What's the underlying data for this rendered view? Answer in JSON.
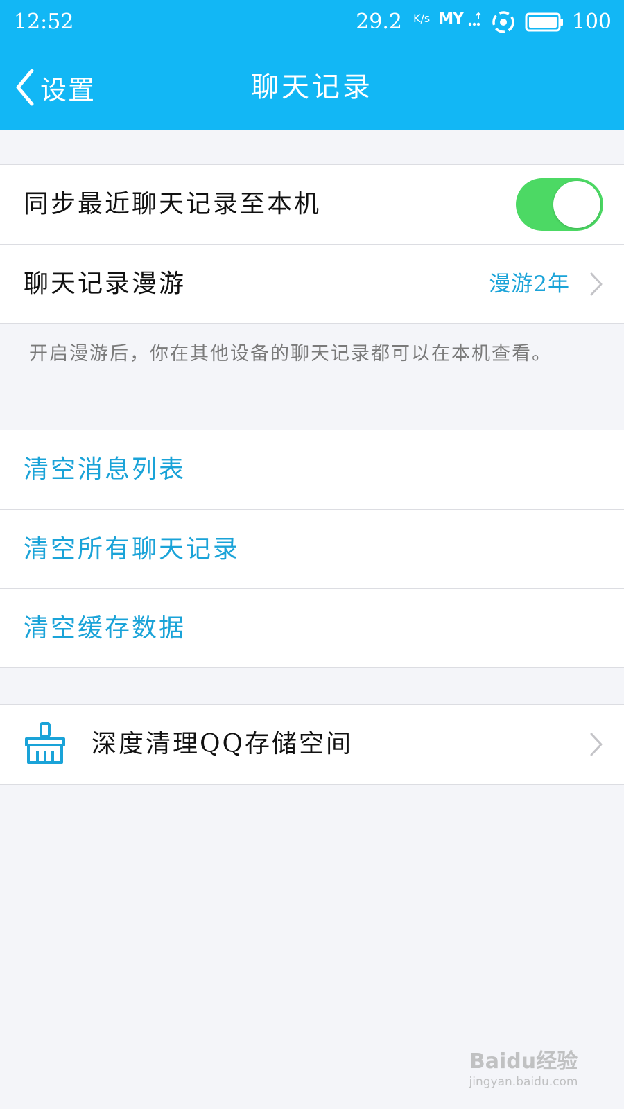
{
  "status_bar": {
    "time": "12:52",
    "net_speed": "29.2",
    "net_speed_unit": "K/s",
    "carrier": "MY",
    "battery": "100"
  },
  "nav": {
    "back_label": "设置",
    "title": "聊天记录"
  },
  "sync_row": {
    "label": "同步最近聊天记录至本机",
    "toggle_on": true
  },
  "roaming_row": {
    "label": "聊天记录漫游",
    "value": "漫游2年"
  },
  "roaming_hint": "开启漫游后，你在其他设备的聊天记录都可以在本机查看。",
  "clear_actions": [
    "清空消息列表",
    "清空所有聊天记录",
    "清空缓存数据"
  ],
  "deep_clean_row": {
    "label": "深度清理QQ存储空间",
    "icon": "broom-icon"
  },
  "watermark": {
    "main": "Baidu经验",
    "sub": "jingyan.baidu.com"
  },
  "colors": {
    "header_bg": "#12b7f5",
    "accent_text": "#1aa3d8",
    "toggle_on": "#4cd964",
    "page_bg": "#f4f5f9"
  }
}
